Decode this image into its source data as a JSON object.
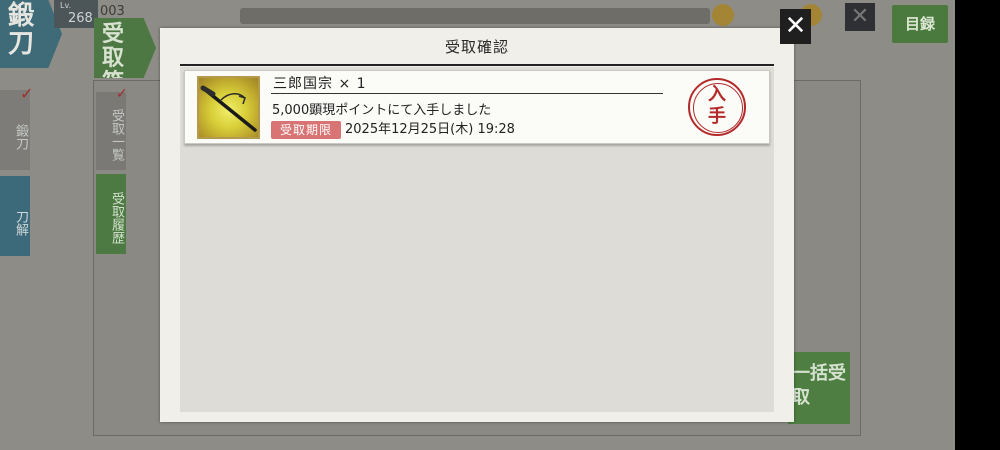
{
  "background": {
    "forge_tab_label": "鍛刀",
    "level_prefix": "Lv.",
    "level_value": "268",
    "sub_count": "003",
    "receive_box_label": "受取箱",
    "side_forge_label": "鍛刀",
    "side_dismantle_label": "刀解",
    "sub_list_label": "受取一覧",
    "sub_history_label": "受取履歴",
    "catalog_button_label": "目録",
    "bulk_receive_label": "一括受取",
    "bg_close_label": "✕"
  },
  "modal": {
    "title": "受取確認",
    "close_label": "✕",
    "items": [
      {
        "name": "三郎国宗 × 1",
        "description": "5,000顕現ポイントにて入手しました",
        "limit_badge": "受取期限",
        "limit_date": "2025年12月25日(木) 19:28",
        "status_stamp": "入手",
        "icon": "sword-icon"
      }
    ]
  },
  "colors": {
    "badge_red": "#d97474",
    "stamp_red": "#b22a2a",
    "green_button": "#4e7843",
    "teal_tab": "#3f6a78"
  }
}
